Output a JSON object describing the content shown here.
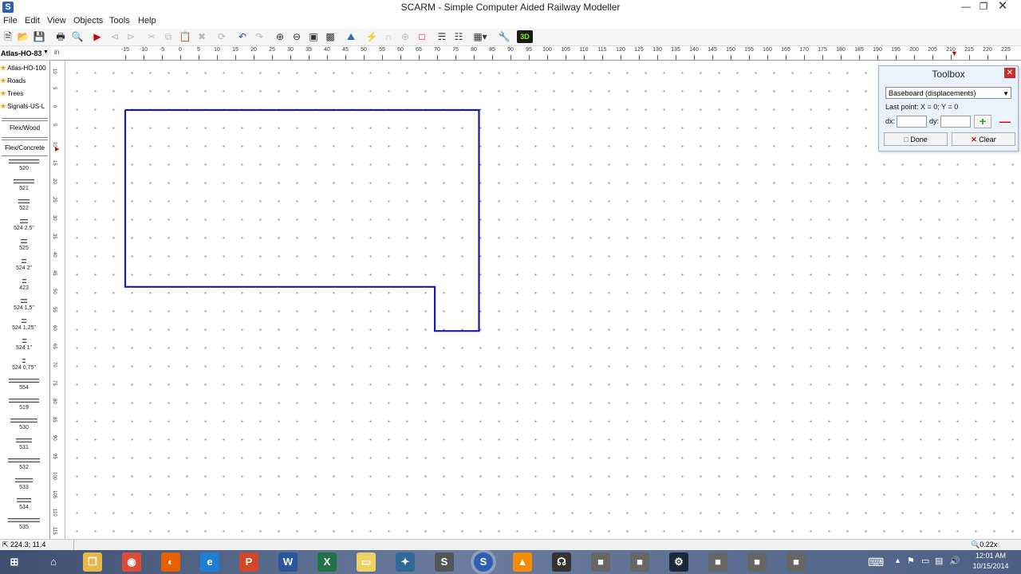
{
  "window": {
    "title": "SCARM - Simple Computer Aided Railway Modeller",
    "minimize_icon": "minimize-icon",
    "maximize_icon": "maximize-icon",
    "close_icon": "close-icon"
  },
  "menu": [
    "File",
    "Edit",
    "View",
    "Objects",
    "Tools",
    "Help"
  ],
  "toolbar_icons": [
    "new-file-icon",
    "open-folder-icon",
    "save-icon",
    "print-icon",
    "print-preview-icon",
    "run-train-icon",
    "back-icon",
    "forward-icon",
    "cut-icon",
    "copy-icon",
    "paste-icon",
    "delete-icon",
    "rotate-icon",
    "undo-icon",
    "redo-icon",
    "zoom-in-icon",
    "zoom-out-icon",
    "zoom-fit-icon",
    "zoom-window-icon",
    "picture-icon",
    "flex-track-icon",
    "tunnel-icon",
    "bridge-icon",
    "height-icon",
    "layers-icon",
    "bridge-view-icon",
    "grid-icon",
    "wagon-icon",
    "view-3d-icon"
  ],
  "toolbar_3d_label": "3D",
  "library": {
    "selected": "Atlas-HO-83",
    "categories": [
      "Atlas-HO-100",
      "Roads",
      "Trees",
      "Signals-US-L"
    ],
    "flex_buttons": [
      "Flex/Wood",
      "Flex/Concrete"
    ],
    "tracks": [
      "520",
      "521",
      "522",
      "524 2,5\"",
      "525",
      "524 2\"",
      "423",
      "524 1,5\"",
      "524 1,25\"",
      "524 1\"",
      "524 0,75\"",
      "554",
      "519",
      "530",
      "531",
      "532",
      "533",
      "534",
      "535"
    ]
  },
  "ruler": {
    "unit": "in",
    "top_labels": [
      "-15",
      "-10",
      "-5",
      "0",
      "5",
      "10",
      "15",
      "20",
      "25",
      "30",
      "35",
      "40",
      "45",
      "50",
      "55",
      "60",
      "65",
      "70",
      "75",
      "80",
      "85",
      "90",
      "95",
      "100",
      "105",
      "110",
      "115",
      "120",
      "125",
      "130",
      "135",
      "140",
      "145",
      "150",
      "155",
      "160",
      "165",
      "170",
      "175",
      "180",
      "185",
      "190",
      "195",
      "200",
      "205",
      "210",
      "215",
      "220",
      "225",
      "230",
      "235",
      "240"
    ],
    "left_labels": [
      "10",
      "5",
      "0",
      "5",
      "10",
      "15",
      "20",
      "25",
      "30",
      "35",
      "40",
      "45",
      "50",
      "55",
      "60",
      "65",
      "70",
      "75",
      "80",
      "85",
      "90",
      "95",
      "100",
      "105",
      "110",
      "115"
    ]
  },
  "baseboard_outline": {
    "points": [
      [
        0,
        0
      ],
      [
        96,
        0
      ],
      [
        96,
        60
      ],
      [
        84,
        60
      ],
      [
        84,
        48
      ],
      [
        0,
        48
      ]
    ],
    "color": "#1a1aa8"
  },
  "toolbox": {
    "title": "Toolbox",
    "mode": "Baseboard (displacements)",
    "last_point": "Last point: X = 0; Y = 0",
    "dx_label": "dx:",
    "dy_label": "dy:",
    "dx_value": "",
    "dy_value": "",
    "add_icon": "plus-icon",
    "remove_icon": "minus-icon",
    "done_label": "Done",
    "clear_label": "Clear"
  },
  "status": {
    "coords": "224.3; 11.4",
    "zoom": "0.22x"
  },
  "taskbar": {
    "apps": [
      "start-icon",
      "home-icon",
      "file-explorer-icon",
      "chrome-icon",
      "firefox-icon",
      "internet-explorer-icon",
      "powerpoint-icon",
      "word-icon",
      "excel-icon",
      "blank-icon",
      "python-icon",
      "solidworks-icon",
      "scarm-icon",
      "vlc-icon",
      "headphones-icon",
      "app-icon",
      "app-icon",
      "steam-icon",
      "app-icon",
      "app-icon",
      "app-icon"
    ],
    "time": "12:01 AM",
    "date": "10/15/2014"
  }
}
